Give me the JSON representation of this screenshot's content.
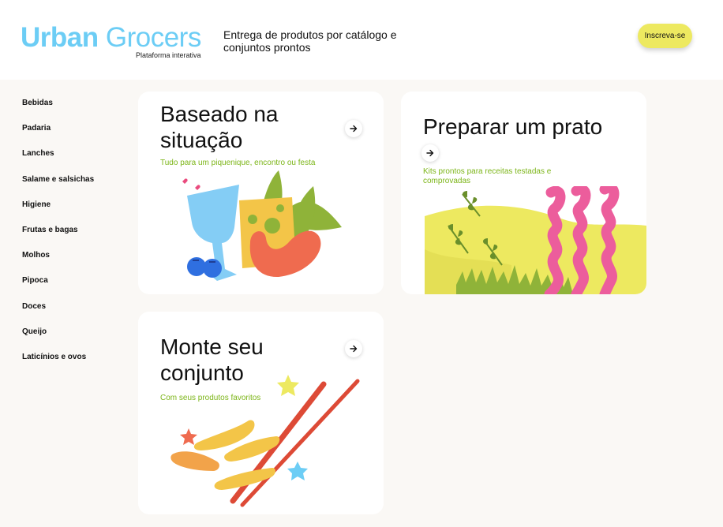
{
  "header": {
    "logo_bold": "Urban",
    "logo_light": " Grocers",
    "logo_sub": "Plataforma interativa",
    "tagline": "Entrega de produtos por catálogo e conjuntos prontos",
    "signup_label": "Inscreva-se"
  },
  "sidebar": {
    "items": [
      {
        "label": "Bebidas"
      },
      {
        "label": "Padaria"
      },
      {
        "label": "Lanches"
      },
      {
        "label": "Salame e salsichas"
      },
      {
        "label": "Higiene"
      },
      {
        "label": "Frutas e bagas"
      },
      {
        "label": "Molhos"
      },
      {
        "label": "Pipoca"
      },
      {
        "label": "Doces"
      },
      {
        "label": "Queijo"
      },
      {
        "label": "Laticínios e ovos"
      }
    ]
  },
  "cards": [
    {
      "title": "Baseado na situação",
      "subtitle": "Tudo para um piquenique, encontro ou festa",
      "arrow_icon": "arrow-right-icon"
    },
    {
      "title": "Preparar um prato",
      "subtitle": "Kits prontos para receitas testadas e comprovadas",
      "arrow_icon": "arrow-right-icon"
    },
    {
      "title": "Monte seu conjunto",
      "subtitle": "Com seus produtos favoritos",
      "arrow_icon": "arrow-right-icon"
    }
  ],
  "colors": {
    "brand": "#6ccdf5",
    "accent_yellow": "#ede960",
    "subtitle_green": "#7cb518",
    "background": "#faf8f5"
  }
}
